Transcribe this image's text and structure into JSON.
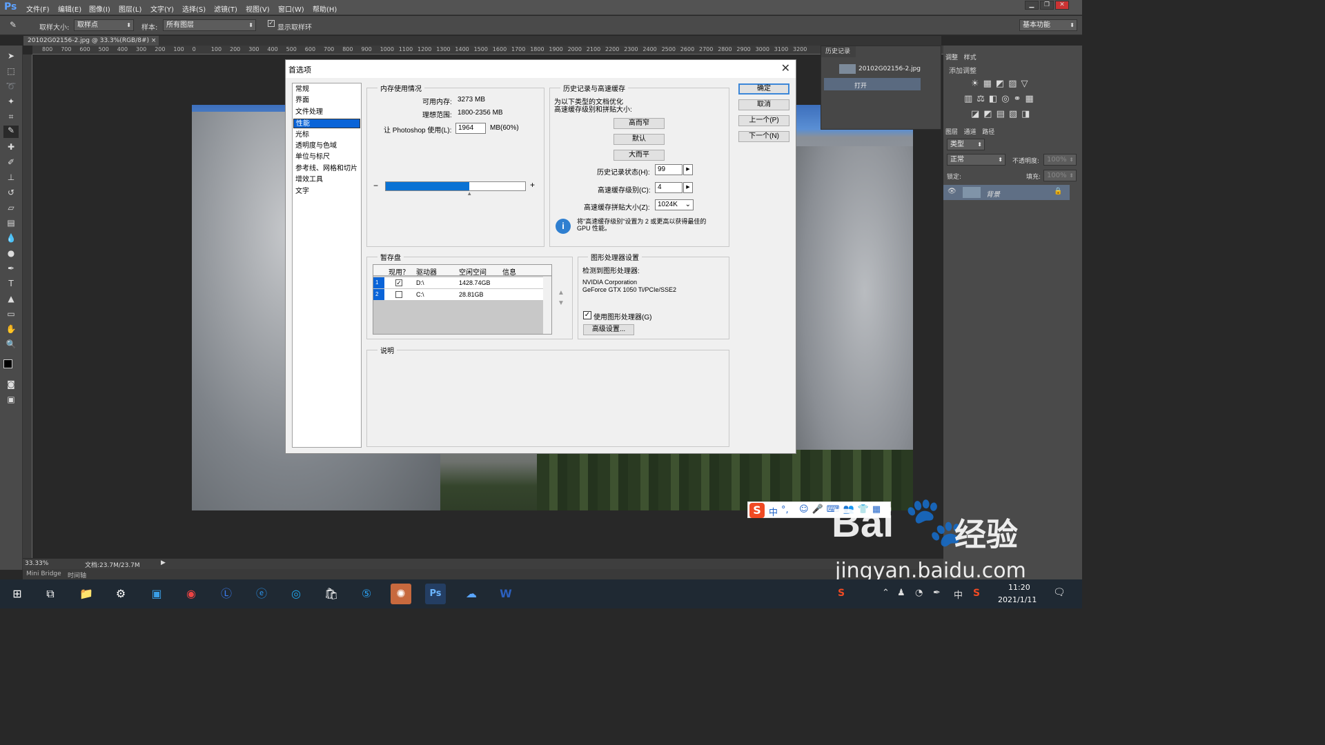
{
  "app": {
    "logo": "Ps"
  },
  "menu": [
    "文件(F)",
    "编辑(E)",
    "图像(I)",
    "图层(L)",
    "文字(Y)",
    "选择(S)",
    "滤镜(T)",
    "视图(V)",
    "窗口(W)",
    "帮助(H)"
  ],
  "options": {
    "sample_size_label": "取样大小:",
    "sample_size_value": "取样点",
    "sample_label": "样本:",
    "sample_value": "所有图层",
    "show_ring_label": "显示取样环",
    "workspace": "基本功能"
  },
  "document": {
    "tab_title": "20102G02156-2.jpg @ 33.3%(RGB/8#)",
    "zoom": "33.33%",
    "doc_size": "文档:23.7M/23.7M"
  },
  "ruler_ticks": [
    "800",
    "700",
    "600",
    "500",
    "400",
    "300",
    "200",
    "100",
    "0",
    "100",
    "200",
    "300",
    "400",
    "500",
    "600",
    "700",
    "800",
    "900",
    "1000",
    "1100",
    "1200",
    "1300",
    "1400",
    "1500",
    "1600",
    "1700",
    "1800",
    "1900",
    "2000",
    "2100",
    "2200",
    "2300",
    "2400",
    "2500",
    "2600",
    "2700",
    "2800",
    "2900",
    "3000",
    "3100",
    "3200"
  ],
  "bottom_tabs": [
    "Mini Bridge",
    "时间轴"
  ],
  "history_panel": {
    "tab": "历史记录",
    "snapshot": "20102G02156-2.jpg",
    "step": "打开"
  },
  "adjust_panel": {
    "tabs": [
      "调整",
      "样式"
    ],
    "add_label": "添加调整"
  },
  "layers_panel": {
    "tabs": [
      "图层",
      "通道",
      "路径"
    ],
    "filter": "类型",
    "blend_mode": "正常",
    "opacity_label": "不透明度:",
    "opacity": "100%",
    "lock_label": "锁定:",
    "fill_label": "填充:",
    "fill": "100%",
    "layer_name": "背景"
  },
  "dialog": {
    "title": "首选项",
    "categories": [
      "常规",
      "界面",
      "文件处理",
      "性能",
      "光标",
      "透明度与色域",
      "单位与标尺",
      "参考线、网格和切片",
      "增效工具",
      "文字"
    ],
    "selected_category_index": 3,
    "buttons": {
      "ok": "确定",
      "cancel": "取消",
      "prev": "上一个(P)",
      "next": "下一个(N)"
    },
    "memory": {
      "group": "内存使用情况",
      "available_label": "可用内存:",
      "available": "3273 MB",
      "ideal_label": "理想范围:",
      "ideal": "1800-2356 MB",
      "let_label": "让 Photoshop 使用(L):",
      "use_value": "1964",
      "use_unit": "MB(60%)",
      "minus": "−",
      "plus": "+",
      "usage_fraction": 0.6
    },
    "history": {
      "group": "历史记录与高速缓存",
      "desc1": "为以下类型的文档优化",
      "desc2": "高速缓存级别和拼贴大小:",
      "btn_tall": "高而窄",
      "btn_default": "默认",
      "btn_wide": "大而平",
      "states_label": "历史记录状态(H):",
      "states": "99",
      "cache_levels_label": "高速缓存级别(C):",
      "cache_levels": "4",
      "tile_label": "高速缓存拼贴大小(Z):",
      "tile": "1024K",
      "info1": "将\"高速缓存级别\"设置为 2 或更高以获得最佳的",
      "info2": "GPU 性能。"
    },
    "scratch": {
      "group": "暂存盘",
      "headers": [
        "现用？",
        "驱动器",
        "空闲空间",
        "信息"
      ],
      "rows": [
        {
          "n": "1",
          "active": true,
          "drive": "D:\\",
          "free": "1428.74GB"
        },
        {
          "n": "2",
          "active": false,
          "drive": "C:\\",
          "free": "28.81GB"
        }
      ]
    },
    "gpu": {
      "group": "图形处理器设置",
      "detected": "检测到图形处理器:",
      "vendor": "NVIDIA Corporation",
      "model": "GeForce GTX 1050 Ti/PCIe/SSE2",
      "use_label": "使用图形处理器(G)",
      "use_checked": true,
      "advanced": "高级设置..."
    },
    "description": {
      "group": "说明"
    }
  },
  "ime": {
    "items": [
      "中",
      "°,"
    ]
  },
  "watermark": {
    "brand": "Bai",
    "brand2": "经验",
    "url": "jingyan.baidu.com"
  },
  "taskbar": {
    "time": "11:20",
    "date": "2021/1/11",
    "lang": "中"
  }
}
